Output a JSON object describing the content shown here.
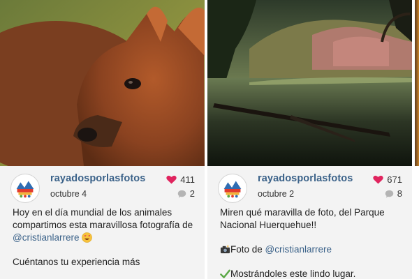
{
  "posts": [
    {
      "username": "rayadosporlasfotos",
      "date": "octubre 4",
      "likes": "411",
      "comments": "2",
      "caption": {
        "line1": "Hoy en el día mundial de los animales compartimos esta maravillosa fotografía de",
        "mention": "@cristianlarrere",
        "emoji": "smiling-face-with-heart-eyes-icon",
        "line2": "Cuéntanos tu experiencia más"
      }
    },
    {
      "username": "rayadosporlasfotos",
      "date": "octubre 2",
      "likes": "671",
      "comments": "8",
      "caption": {
        "line1": "Miren qué maravilla de foto, del Parque Nacional Huerquehue!!",
        "photo_prefix": "Foto de",
        "mention": "@cristianlarrere",
        "line3": "Mostrándoles este lindo lugar."
      }
    }
  ],
  "colors": {
    "username": "#3b6289",
    "heart": "#e0245e",
    "card_bg": "#f3f3f3"
  }
}
